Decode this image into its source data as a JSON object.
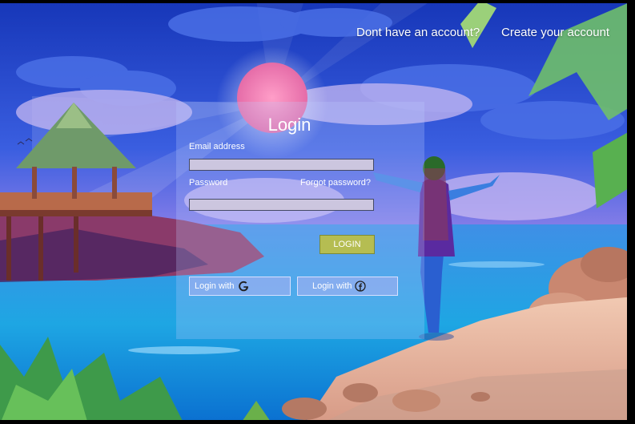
{
  "nav": {
    "prompt": "Dont have an account?",
    "create_link": "Create  your account"
  },
  "login": {
    "title": "Login",
    "email_label": "Email address",
    "email_value": "",
    "password_label": "Password",
    "password_value": "",
    "forgot_link": "Forgot password?",
    "submit_label": "LOGIN"
  },
  "social": {
    "google_label": "Login with",
    "google_icon": "google-icon",
    "facebook_label": "Login with",
    "facebook_icon": "facebook-icon"
  },
  "colors": {
    "sky_top": "#1a3bc4",
    "sea": "#1aa0e0",
    "sand": "#e9bfa9",
    "login_button": "#b5bd52",
    "card_overlay": "#becdff"
  }
}
